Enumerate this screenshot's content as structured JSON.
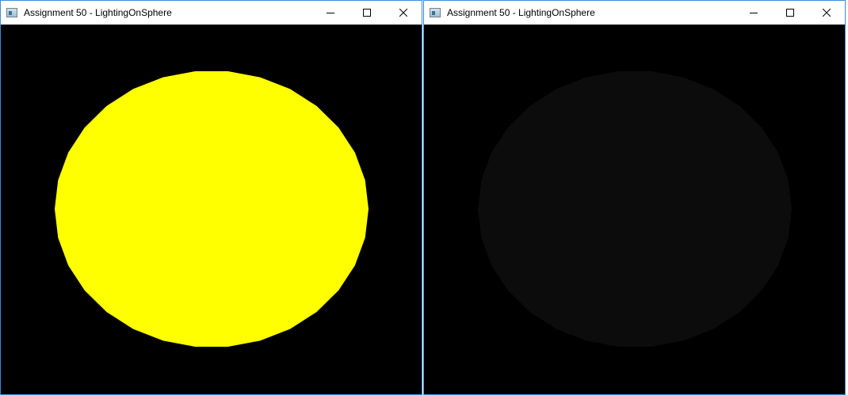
{
  "windows": [
    {
      "title": "Assignment 50 - LightingOnSphere",
      "client_background": "#000000",
      "sphere_color": "#ffff00",
      "icons": {
        "app": "window-app-icon",
        "minimize": "minimize-icon",
        "maximize": "maximize-icon",
        "close": "close-icon"
      }
    },
    {
      "title": "Assignment 50 - LightingOnSphere",
      "client_background": "#000000",
      "sphere_color": "#0c0c0c",
      "icons": {
        "app": "window-app-icon",
        "minimize": "minimize-icon",
        "maximize": "maximize-icon",
        "close": "close-icon"
      }
    }
  ],
  "colors": {
    "window_border": "#3c8dd4",
    "titlebar": "#ffffff"
  }
}
